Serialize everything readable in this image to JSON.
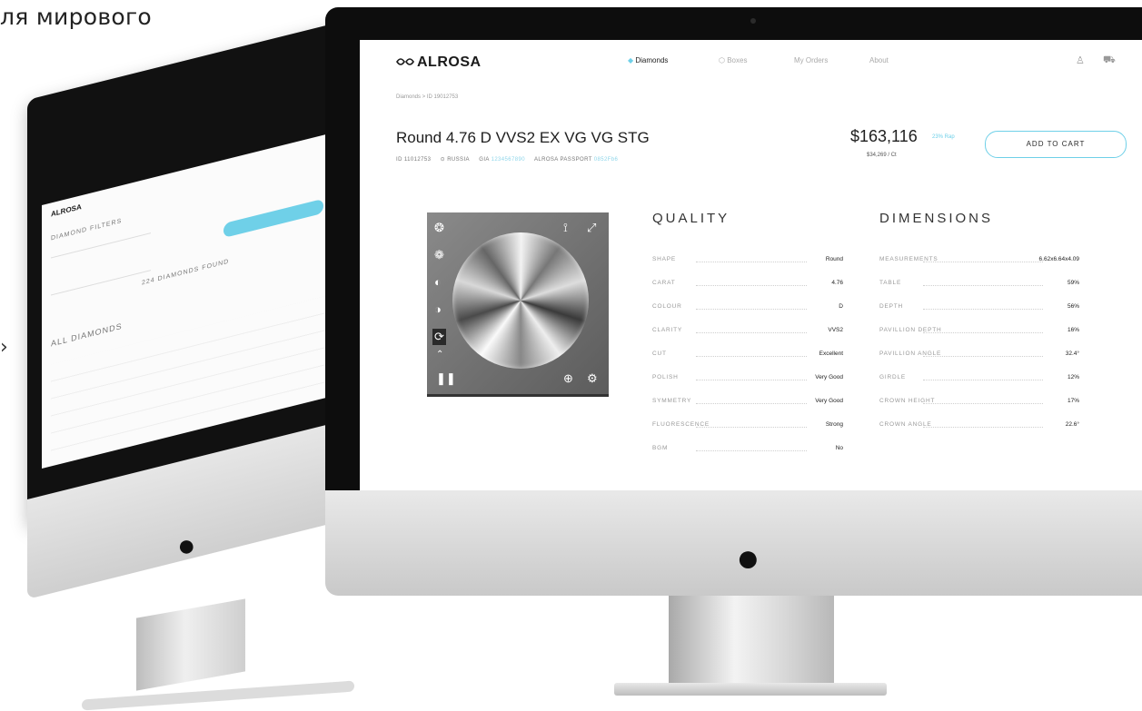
{
  "background": {
    "headline_fragment": "ля мирового",
    "bullet": "›"
  },
  "back_screen": {
    "logo": "ALROSA",
    "filters_title": "DIAMOND FILTERS",
    "all_diamonds": "ALL DIAMONDS",
    "found": "224 DIAMONDS FOUND"
  },
  "nav": {
    "logo": "ALROSA",
    "items": [
      "Diamonds",
      "Boxes",
      "My Orders",
      "About"
    ],
    "user_icon": "user-icon",
    "cart_icon": "cart-icon"
  },
  "breadcrumb": "Diamonds  >  ID 19012753",
  "product": {
    "title": "Round 4.76 D  VVS2  EX VG VG STG",
    "meta_id": "ID 11012753",
    "meta_origin": "RUSSIA",
    "meta_gia_label": "GIA",
    "meta_gia_value": "1234567890",
    "meta_passport_label": "ALROSA PASSPORT",
    "meta_passport_value": "0852Fb6",
    "price": "$163,116",
    "rap": "23% Rap",
    "price_per_ct": "$34,269 / Ct",
    "add_to_cart": "ADD TO CART"
  },
  "quality": {
    "title": "QUALITY",
    "rows": [
      {
        "k": "SHAPE",
        "v": "Round"
      },
      {
        "k": "CARAT",
        "v": "4.76"
      },
      {
        "k": "COLOUR",
        "v": "D"
      },
      {
        "k": "CLARITY",
        "v": "VVS2"
      },
      {
        "k": "CUT",
        "v": "Excellent"
      },
      {
        "k": "POLISH",
        "v": "Very Good"
      },
      {
        "k": "SYMMETRY",
        "v": "Very Good"
      },
      {
        "k": "FLUORESCENCE",
        "v": "Strong"
      },
      {
        "k": "BGM",
        "v": "No"
      }
    ]
  },
  "dimensions": {
    "title": "DIMENSIONS",
    "rows": [
      {
        "k": "MEASUREMENTS",
        "v": "6.62x6.64x4.09"
      },
      {
        "k": "TABLE",
        "v": "59%"
      },
      {
        "k": "DEPTH",
        "v": "56%"
      },
      {
        "k": "PAVILLION DEPTH",
        "v": "16%"
      },
      {
        "k": "PAVILLION ANGLE",
        "v": "32.4°"
      },
      {
        "k": "GIRDLE",
        "v": "12%"
      },
      {
        "k": "CROWN HEIGHT",
        "v": "17%"
      },
      {
        "k": "CROWN ANGLE",
        "v": "22.6°"
      }
    ]
  },
  "colors": {
    "accent": "#6fd0e8",
    "bezel": "#0d0d0d"
  }
}
